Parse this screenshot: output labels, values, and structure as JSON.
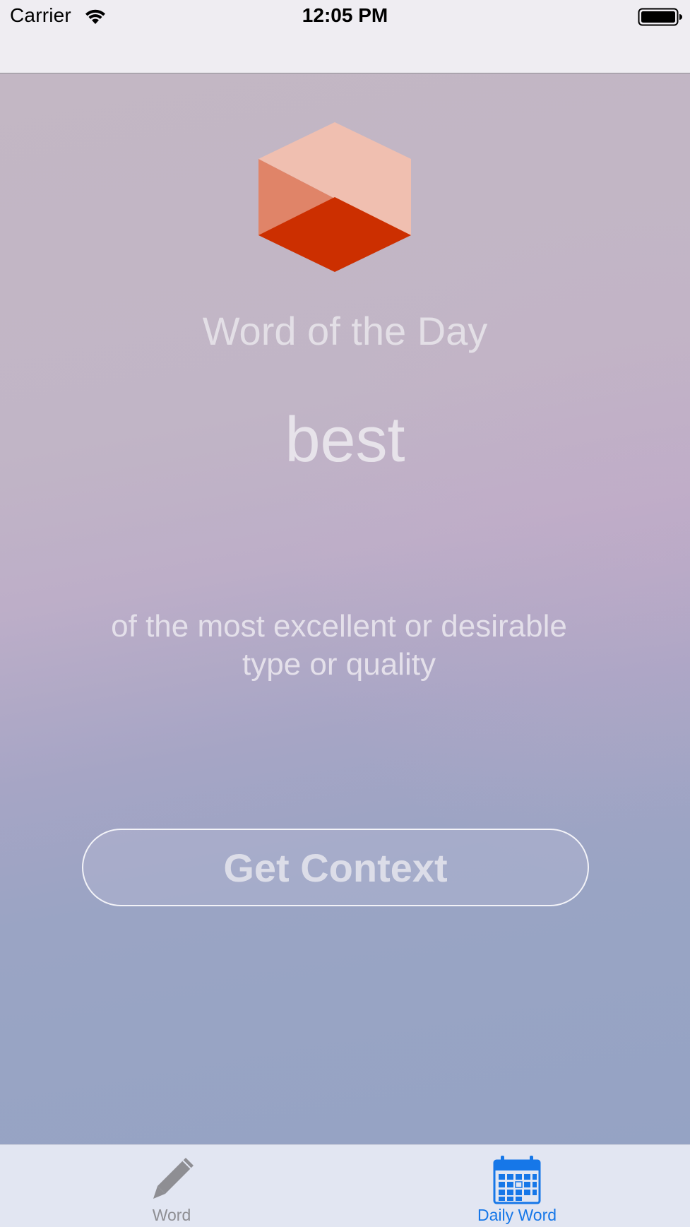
{
  "status_bar": {
    "carrier": "Carrier",
    "time": "12:05 PM",
    "wifi_icon": "wifi-icon",
    "battery_icon": "battery-full-icon"
  },
  "main": {
    "logo_icon": "cube-logo-icon",
    "title": "Word of the Day",
    "word": "best",
    "definition": "of the most excellent or desirable type or quality",
    "context_button_label": "Get Context"
  },
  "tab_bar": {
    "selected_tab": "Daily Word",
    "tabs": [
      {
        "label": "Word",
        "icon": "pencil-icon",
        "color": "#8e8e93"
      },
      {
        "label": "Daily Word",
        "icon": "calendar-icon",
        "color": "#1677e8"
      }
    ]
  },
  "colors": {
    "accent": "#1677e8",
    "cube_dark": "#cc2f00",
    "cube_light": "#f0bfb0",
    "cube_mid": "#e08468"
  }
}
